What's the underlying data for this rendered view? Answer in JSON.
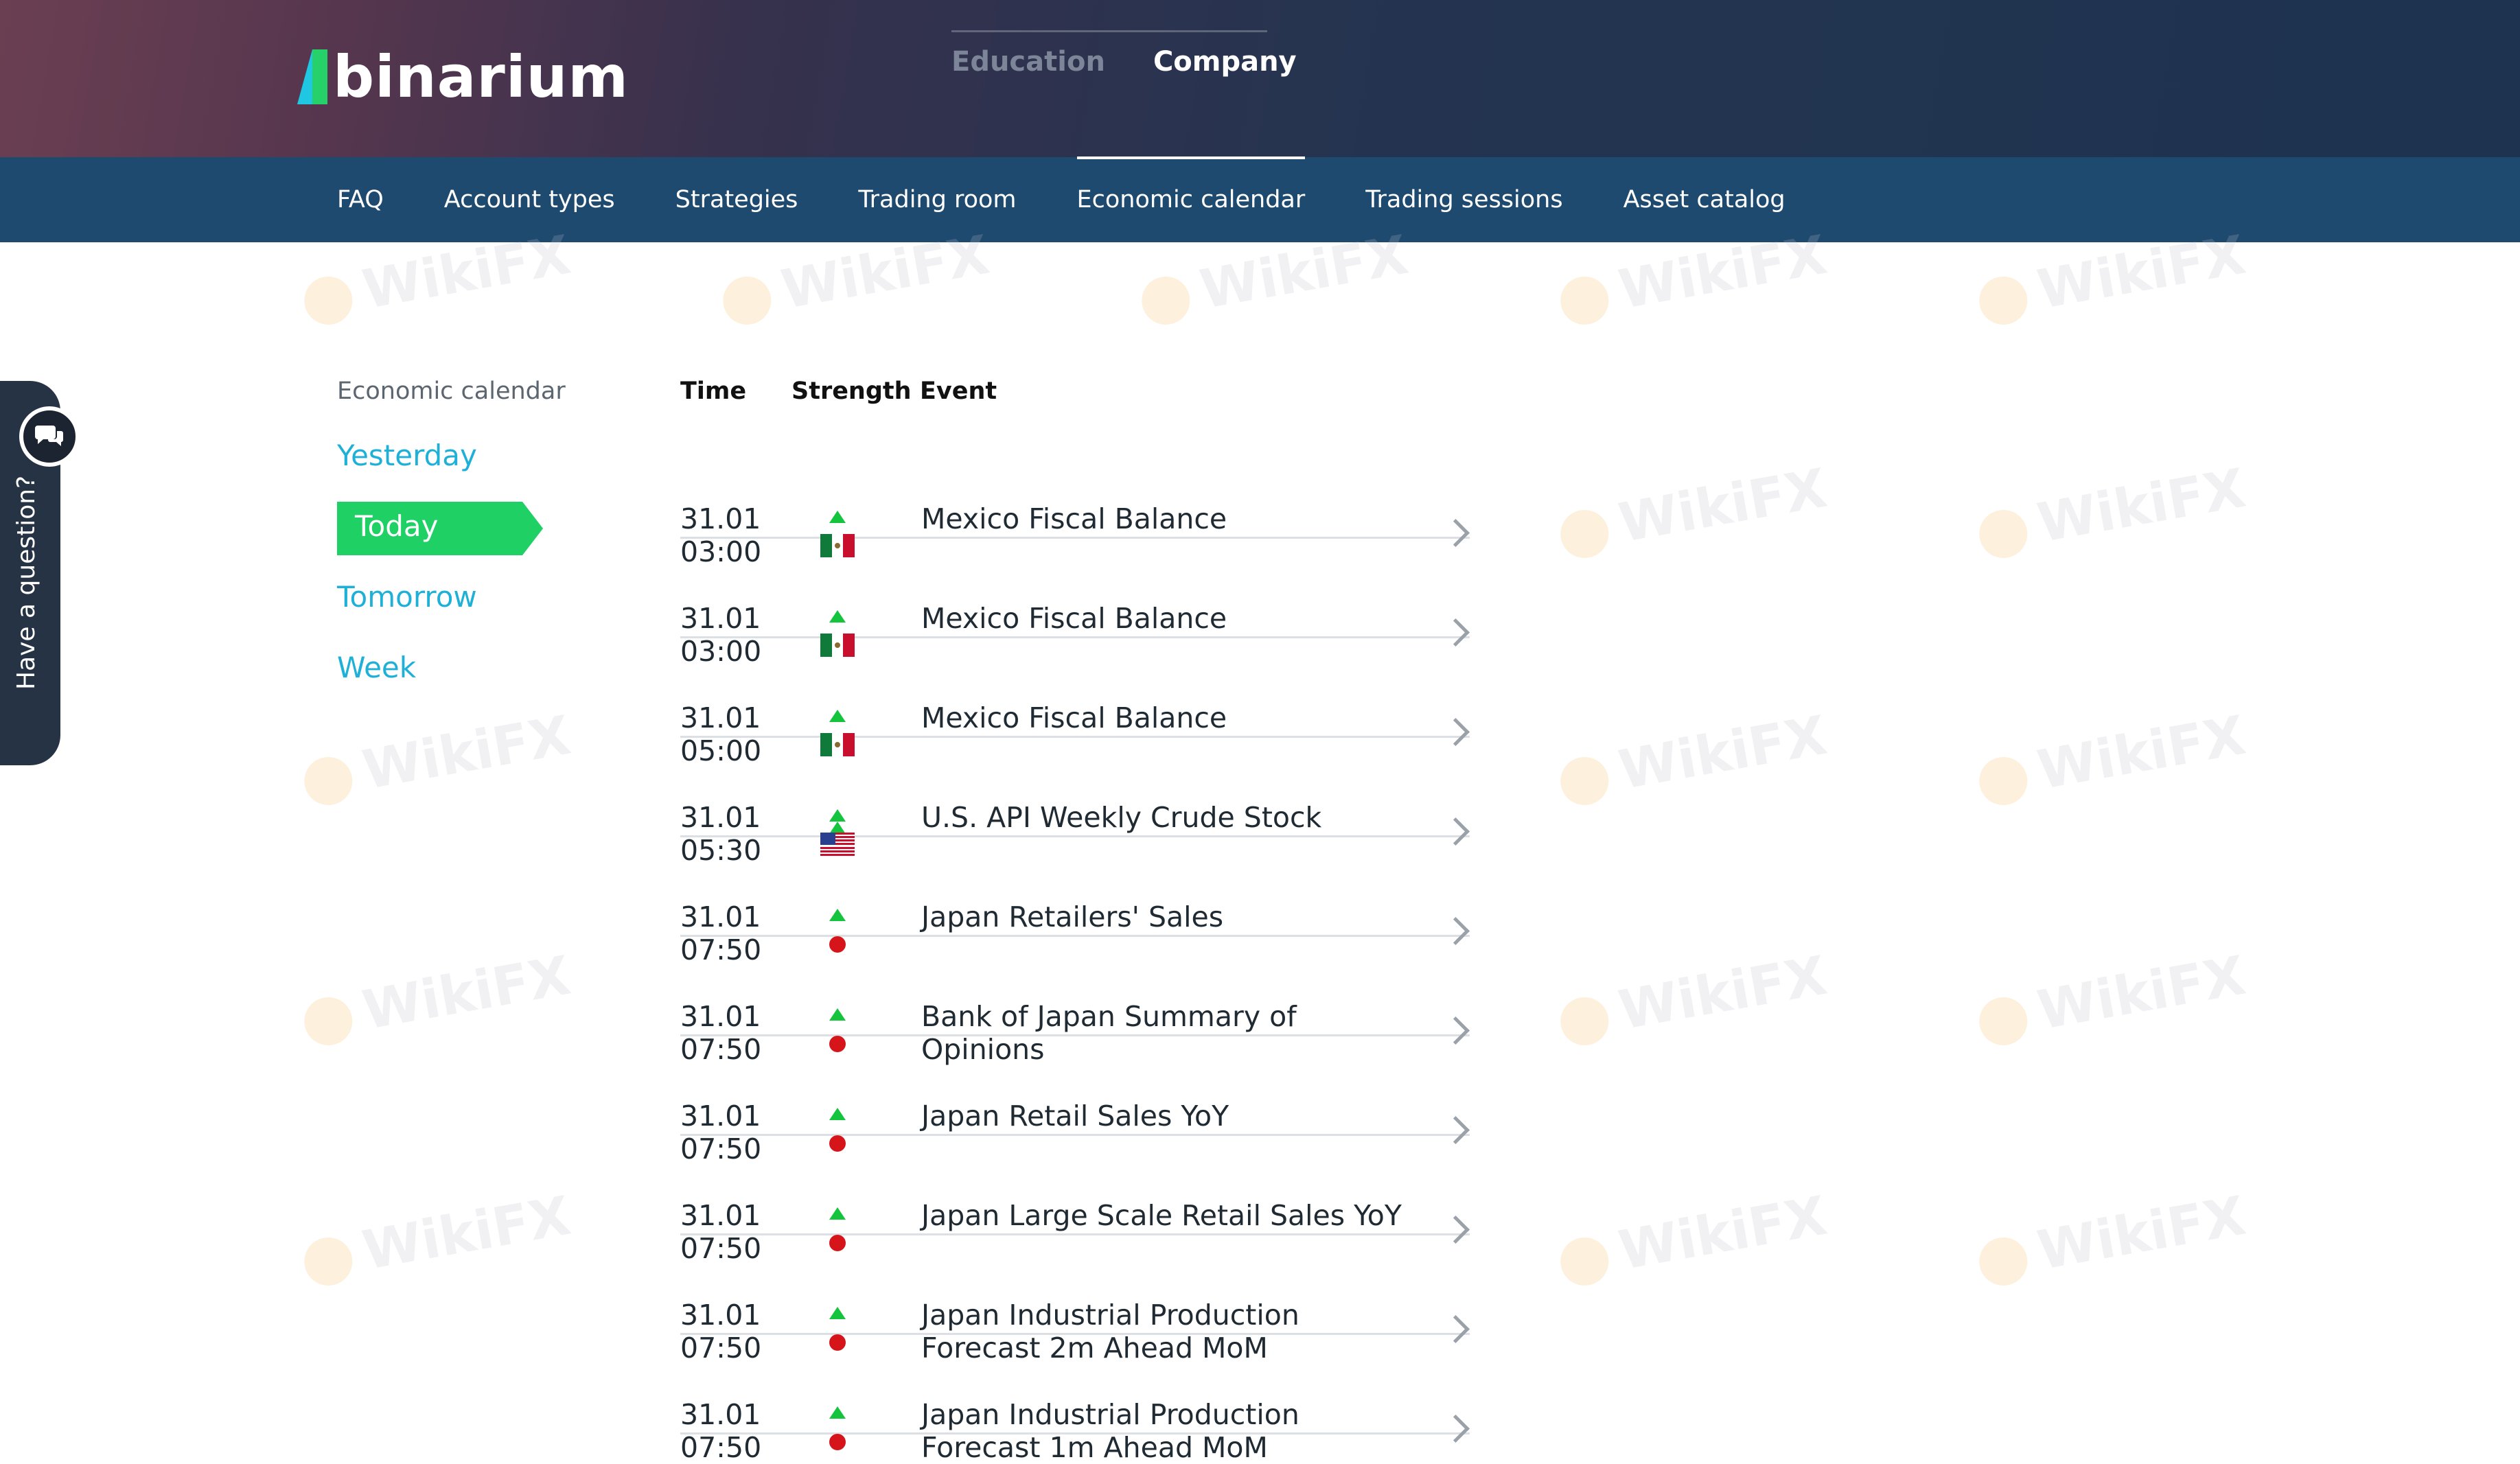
{
  "brand": {
    "name": "binarium"
  },
  "top_nav": [
    {
      "label": "Education",
      "active": false
    },
    {
      "label": "Company",
      "active": true
    }
  ],
  "sub_nav": [
    {
      "label": "FAQ",
      "active": false
    },
    {
      "label": "Account types",
      "active": false
    },
    {
      "label": "Strategies",
      "active": false
    },
    {
      "label": "Trading room",
      "active": false
    },
    {
      "label": "Economic calendar",
      "active": true
    },
    {
      "label": "Trading sessions",
      "active": false
    },
    {
      "label": "Asset catalog",
      "active": false
    }
  ],
  "side_menu": {
    "title": "Economic calendar",
    "items": [
      {
        "label": "Yesterday",
        "active": false
      },
      {
        "label": "Today",
        "active": true
      },
      {
        "label": "Tomorrow",
        "active": false
      },
      {
        "label": "Week",
        "active": false
      }
    ]
  },
  "help_tab": {
    "label": "Have a question?",
    "icon": "chat-bubbles-icon"
  },
  "table": {
    "headers": {
      "time": "Time",
      "strength": "Strength",
      "event": "Event"
    },
    "rows": [
      {
        "date": "31.01",
        "time": "03:00",
        "strength": 1,
        "country": "mexico-flag",
        "event": "Mexico Fiscal Balance"
      },
      {
        "date": "31.01",
        "time": "03:00",
        "strength": 1,
        "country": "mexico-flag",
        "event": "Mexico Fiscal Balance"
      },
      {
        "date": "31.01",
        "time": "05:00",
        "strength": 1,
        "country": "mexico-flag",
        "event": "Mexico Fiscal Balance"
      },
      {
        "date": "31.01",
        "time": "05:30",
        "strength": 2,
        "country": "usa-flag",
        "event": "U.S. API Weekly Crude Stock"
      },
      {
        "date": "31.01",
        "time": "07:50",
        "strength": 1,
        "country": "japan-flag",
        "event": "Japan Retailers' Sales"
      },
      {
        "date": "31.01",
        "time": "07:50",
        "strength": 1,
        "country": "japan-flag",
        "event": "Bank of Japan Summary of Opinions"
      },
      {
        "date": "31.01",
        "time": "07:50",
        "strength": 1,
        "country": "japan-flag",
        "event": "Japan Retail Sales YoY"
      },
      {
        "date": "31.01",
        "time": "07:50",
        "strength": 1,
        "country": "japan-flag",
        "event": "Japan Large Scale Retail Sales YoY"
      },
      {
        "date": "31.01",
        "time": "07:50",
        "strength": 1,
        "country": "japan-flag",
        "event": "Japan Industrial Production Forecast 2m Ahead MoM"
      },
      {
        "date": "31.01",
        "time": "07:50",
        "strength": 1,
        "country": "japan-flag",
        "event": "Japan Industrial Production Forecast 1m Ahead MoM"
      }
    ]
  },
  "watermark": {
    "text": "WikiFX"
  },
  "colors": {
    "accent_green": "#1fd065",
    "link_blue": "#1fb0d8",
    "subnav_bg": "#1e4a70",
    "strength_up": "#14c43c",
    "japan_red": "#d6151a"
  }
}
